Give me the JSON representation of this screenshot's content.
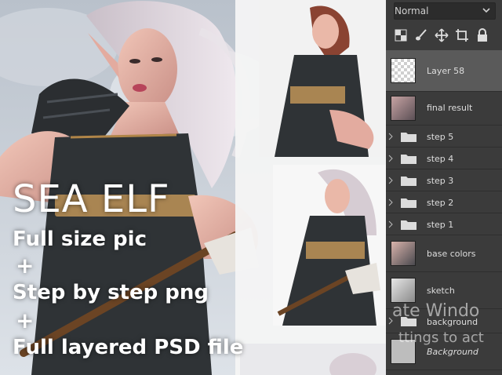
{
  "promo": {
    "title": "SEA ELF",
    "line1": "Full size pic",
    "plus1": "+",
    "line2": "Step by step png",
    "plus2": "+",
    "line3": "Full layered PSD file"
  },
  "panel": {
    "blend_mode": "Normal",
    "tools": [
      "checker-icon",
      "brush-icon",
      "move-icon",
      "crop-icon",
      "lock-icon"
    ],
    "layers": [
      {
        "name": "Layer 58",
        "kind": "image",
        "selected": true
      },
      {
        "name": "final result",
        "kind": "image"
      },
      {
        "name": "step 5",
        "kind": "folder"
      },
      {
        "name": "step 4",
        "kind": "folder"
      },
      {
        "name": "step 3",
        "kind": "folder"
      },
      {
        "name": "step 2",
        "kind": "folder"
      },
      {
        "name": "step 1",
        "kind": "folder"
      },
      {
        "name": "base colors",
        "kind": "image"
      },
      {
        "name": "sketch",
        "kind": "image"
      },
      {
        "name": "background",
        "kind": "folder"
      },
      {
        "name": "Background",
        "kind": "image"
      }
    ]
  },
  "watermark": {
    "line1": "ate Windo",
    "line2": "ttings to act"
  },
  "colors": {
    "panel_bg": "#3b3b3b",
    "selected_row": "#5a5a5a",
    "sky": "#c9d0d9",
    "skin": "#e7b7a8",
    "hair": "#d9cfd6",
    "dress": "#2f3336"
  }
}
